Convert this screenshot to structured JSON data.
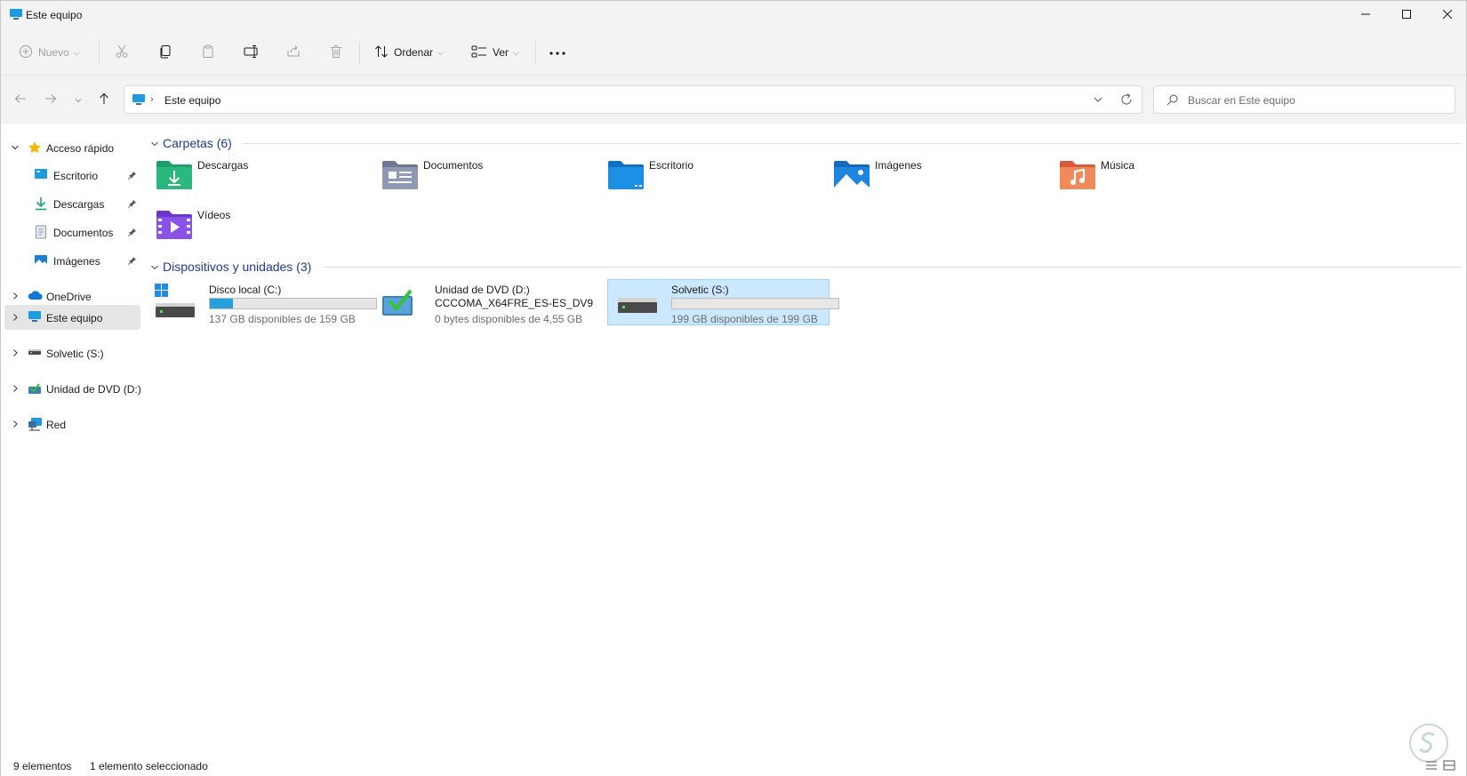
{
  "window": {
    "title": "Este equipo",
    "controls": [
      "minimize-icon",
      "maximize-icon",
      "close-icon"
    ]
  },
  "toolbar": {
    "new_label": "Nuevo",
    "sort_label": "Ordenar",
    "view_label": "Ver",
    "icons": [
      "plus-icon",
      "cut-icon",
      "copy-icon",
      "paste-icon",
      "rename-icon",
      "share-icon",
      "delete-icon",
      "sort-icon",
      "view-icon",
      "more-icon"
    ]
  },
  "address": {
    "crumb": "Este equipo",
    "search_placeholder": "Buscar en Este equipo"
  },
  "sidebar": {
    "quick_access": "Acceso rápido",
    "quick_items": [
      {
        "label": "Escritorio",
        "icon": "desktop-icon"
      },
      {
        "label": "Descargas",
        "icon": "download-icon"
      },
      {
        "label": "Documentos",
        "icon": "document-icon"
      },
      {
        "label": "Imágenes",
        "icon": "pictures-icon"
      }
    ],
    "onedrive": "OneDrive",
    "this_pc": "Este equipo",
    "solvetic": "Solvetic (S:)",
    "dvd": "Unidad de DVD (D:)",
    "network": "Red"
  },
  "folders": {
    "header": "Carpetas (6)",
    "items": [
      {
        "name": "Descargas",
        "icon": "downloads-folder-icon"
      },
      {
        "name": "Documentos",
        "icon": "documents-folder-icon"
      },
      {
        "name": "Escritorio",
        "icon": "desktop-folder-icon"
      },
      {
        "name": "Imágenes",
        "icon": "pictures-folder-icon"
      },
      {
        "name": "Música",
        "icon": "music-folder-icon"
      },
      {
        "name": "Vídeos",
        "icon": "videos-folder-icon"
      }
    ]
  },
  "devices": {
    "header": "Dispositivos y unidades (3)",
    "items": [
      {
        "name": "Disco local (C:)",
        "free": "137 GB disponibles de 159 GB",
        "used_fraction": 0.14
      },
      {
        "name": "Unidad de DVD (D:)",
        "subtitle": "CCCOMA_X64FRE_ES-ES_DV9",
        "free": "0 bytes disponibles de 4,55 GB"
      },
      {
        "name": "Solvetic (S:)",
        "free": "199 GB disponibles de 199 GB",
        "used_fraction": 0.0
      }
    ]
  },
  "status": {
    "count": "9 elementos",
    "selected": "1 elemento seleccionado"
  },
  "colors": {
    "accent": "#26a0da",
    "selection": "#cce8ff",
    "group_header": "#1e3a8a"
  }
}
